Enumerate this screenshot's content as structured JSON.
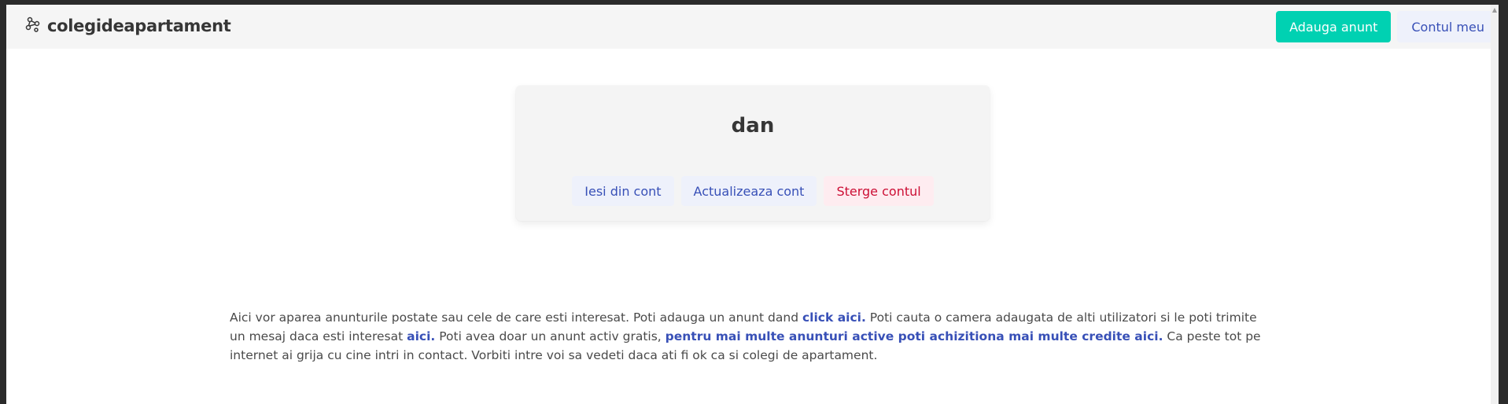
{
  "navbar": {
    "brand_icon": "share-nodes-icon",
    "brand": "colegideapartament",
    "add_listing": "Adauga anunt",
    "my_account": "Contul meu"
  },
  "profile": {
    "username": "dan",
    "logout": "Iesi din cont",
    "update": "Actualizeaza cont",
    "delete": "Sterge contul"
  },
  "info": {
    "p1": "Aici vor aparea anunturile postate sau cele de care esti interesat. Poti adauga un anunt dand ",
    "link1": "click aici.",
    "p2": " Poti cauta o camera adaugata de alti utilizatori si le poti trimite un mesaj daca esti interesat ",
    "link2": "aici.",
    "p3": " Poti avea doar un anunt activ gratis, ",
    "link3": "pentru mai multe anunturi active poti achizitiona mai multe credite aici.",
    "p4": " Ca peste tot pe internet ai grija cu cine intri in contact. Vorbiti intre voi sa vedeti daca ati fi ok ca si colegi de apartament."
  },
  "colors": {
    "primary": "#00d1b2",
    "link": "#3850b7",
    "danger": "#cc0f35",
    "navbar_bg": "#f5f5f5",
    "card_bg": "#f4f4f4"
  }
}
